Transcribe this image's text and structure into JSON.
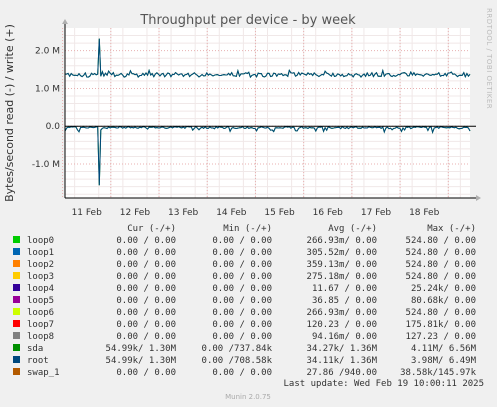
{
  "chart_data": {
    "type": "line",
    "title": "Throughput per device - by week",
    "ylabel": "Bytes/second read (-) / write (+)",
    "side_label": "RRDTOOL / TOBI OETIKER",
    "ylim": [
      -1.9,
      2.6
    ],
    "yticks": [
      {
        "v": 2.0,
        "label": "2.0 M"
      },
      {
        "v": 1.0,
        "label": "1.0 M"
      },
      {
        "v": 0.0,
        "label": "0.0"
      },
      {
        "v": -1.0,
        "label": "-1.0 M"
      }
    ],
    "x_range": [
      10.55,
      18.95
    ],
    "xticks": [
      {
        "v": 11,
        "label": "11 Feb"
      },
      {
        "v": 12,
        "label": "12 Feb"
      },
      {
        "v": 13,
        "label": "13 Feb"
      },
      {
        "v": 14,
        "label": "14 Feb"
      },
      {
        "v": 15,
        "label": "15 Feb"
      },
      {
        "v": 16,
        "label": "16 Feb"
      },
      {
        "v": 17,
        "label": "17 Feb"
      },
      {
        "v": 18,
        "label": "18 Feb"
      }
    ],
    "series_data": {
      "x_start": 10.55,
      "x_end": 18.95,
      "write_mean": 1.36,
      "read_mean": -0.0345,
      "write_spikes": [
        {
          "x": 11.25,
          "y": 2.32
        }
      ],
      "read_spikes": [
        {
          "x": 11.25,
          "y": -1.56
        }
      ]
    },
    "columns": [
      "Cur (-/+)",
      "Min (-/+)",
      "Avg (-/+)",
      "Max (-/+)"
    ],
    "series": [
      {
        "name": "loop0",
        "color": "#00cc00",
        "cur": "0.00 /  0.00",
        "min": "0.00 /  0.00",
        "avg": "266.93m/  0.00",
        "max": "524.80 /  0.00"
      },
      {
        "name": "loop1",
        "color": "#0066b3",
        "cur": "0.00 /  0.00",
        "min": "0.00 /  0.00",
        "avg": "305.52m/  0.00",
        "max": "524.80 /  0.00"
      },
      {
        "name": "loop2",
        "color": "#ff8000",
        "cur": "0.00 /  0.00",
        "min": "0.00 /  0.00",
        "avg": "359.13m/  0.00",
        "max": "524.80 /  0.00"
      },
      {
        "name": "loop3",
        "color": "#ffcc00",
        "cur": "0.00 /  0.00",
        "min": "0.00 /  0.00",
        "avg": "275.18m/  0.00",
        "max": "524.80 /  0.00"
      },
      {
        "name": "loop4",
        "color": "#330099",
        "cur": "0.00 /  0.00",
        "min": "0.00 /  0.00",
        "avg": "11.67 /  0.00",
        "max": "25.24k/  0.00"
      },
      {
        "name": "loop5",
        "color": "#990099",
        "cur": "0.00 /  0.00",
        "min": "0.00 /  0.00",
        "avg": "36.85 /  0.00",
        "max": "80.68k/  0.00"
      },
      {
        "name": "loop6",
        "color": "#ccff00",
        "cur": "0.00 /  0.00",
        "min": "0.00 /  0.00",
        "avg": "266.93m/  0.00",
        "max": "524.80 /  0.00"
      },
      {
        "name": "loop7",
        "color": "#ff0000",
        "cur": "0.00 /  0.00",
        "min": "0.00 /  0.00",
        "avg": "120.23 /  0.00",
        "max": "175.81k/  0.00"
      },
      {
        "name": "loop8",
        "color": "#808080",
        "cur": "0.00 /  0.00",
        "min": "0.00 /  0.00",
        "avg": "94.16m/  0.00",
        "max": "127.23 /  0.00"
      },
      {
        "name": "sda",
        "color": "#008f00",
        "cur": "54.99k/  1.30M",
        "min": "0.00 /737.84k",
        "avg": "34.27k/  1.36M",
        "max": "4.11M/  6.56M"
      },
      {
        "name": "root",
        "color": "#00487d",
        "cur": "54.99k/  1.30M",
        "min": "0.00 /708.58k",
        "avg": "34.11k/  1.36M",
        "max": "3.98M/  6.49M"
      },
      {
        "name": "swap_1",
        "color": "#b35a00",
        "cur": "0.00 /  0.00",
        "min": "0.00 /  0.00",
        "avg": "27.86 /940.00",
        "max": "38.58k/145.97k"
      }
    ],
    "last_update": "Last update: Wed Feb 19 10:00:11 2025",
    "footer": "Munin 2.0.75"
  }
}
